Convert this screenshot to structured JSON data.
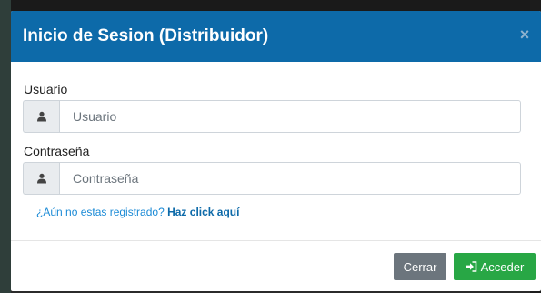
{
  "modal": {
    "title": "Inicio de Sesion (Distribuidor)",
    "close_symbol": "×",
    "header_color": "#0d6aa9"
  },
  "form": {
    "user": {
      "label": "Usuario",
      "placeholder": "Usuario",
      "icon": "user-icon"
    },
    "password": {
      "label": "Contraseña",
      "placeholder": "Contraseña",
      "icon": "user-icon"
    },
    "register": {
      "question": "¿Aún no estas registrado?",
      "link": "Haz click aquí"
    }
  },
  "footer": {
    "close_label": "Cerrar",
    "submit_label": "Acceder",
    "submit_icon": "sign-in-icon",
    "submit_color": "#28a745",
    "close_color": "#6c757d"
  }
}
